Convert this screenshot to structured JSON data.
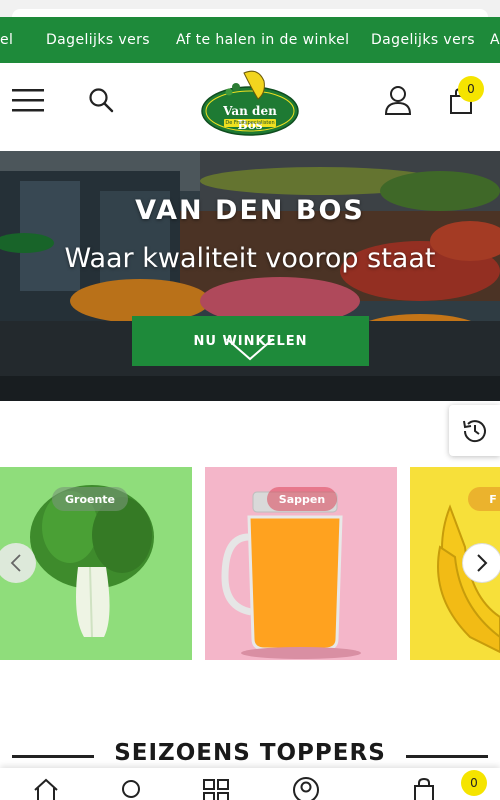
{
  "announcement": {
    "items": [
      "el",
      "Dagelijks vers",
      "Af te halen in de winkel",
      "Dagelijks vers",
      "A"
    ],
    "bg_color": "#1e8a3a"
  },
  "header": {
    "logo_name": "Van den Bos",
    "logo_tagline": "De Fruitspecialisten",
    "menu_icon": "hamburger-icon",
    "search_icon": "search-icon",
    "account_icon": "user-icon",
    "cart_icon": "shopping-bag-icon",
    "cart_count": "0"
  },
  "hero": {
    "title": "VAN DEN BOS",
    "subtitle": "Waar kwaliteit voorop staat",
    "cta_label": "NU WINKELEN"
  },
  "recent_tab": {
    "icon": "history-icon"
  },
  "categories": [
    {
      "label": "Groente",
      "color": "#8fdd7b"
    },
    {
      "label": "Sappen",
      "color": "#f4b6c9"
    },
    {
      "label": "F",
      "color": "#f7e03a"
    }
  ],
  "section": {
    "title": "SEIZOENS TOPPERS"
  },
  "bottom_nav": {
    "items": [
      "home-icon",
      "search-icon",
      "grid-icon",
      "account-icon",
      "cart-icon"
    ],
    "cart_count": "0"
  },
  "colors": {
    "accent": "#1e8a3a",
    "badge": "#f5e400"
  }
}
